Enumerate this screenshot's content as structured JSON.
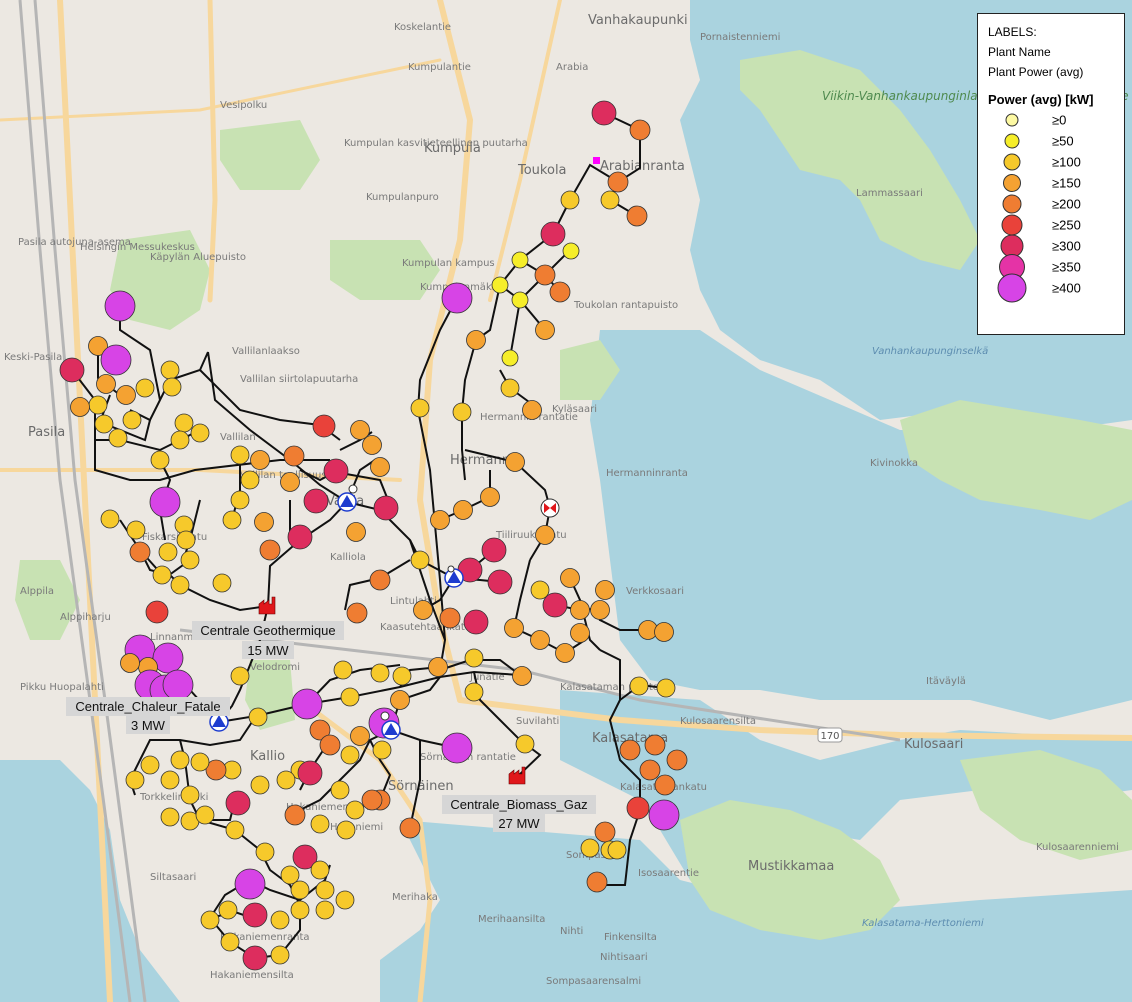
{
  "map": {
    "places": [
      {
        "name": "Vanhakaupunki",
        "cls": "place"
      },
      {
        "name": "Kumpula",
        "cls": "place"
      },
      {
        "name": "Toukola",
        "cls": "place"
      },
      {
        "name": "Arabianranta",
        "cls": "place"
      },
      {
        "name": "Pasila",
        "cls": "place"
      },
      {
        "name": "Keski-Pasila",
        "cls": "place-sm"
      },
      {
        "name": "Pasila autojuna-asema",
        "cls": "place-sm"
      },
      {
        "name": "Hermanni",
        "cls": "place"
      },
      {
        "name": "Kyläsaari",
        "cls": "place-sm"
      },
      {
        "name": "Hermanninranta",
        "cls": "place-sm"
      },
      {
        "name": "Verkkosaari",
        "cls": "place-sm"
      },
      {
        "name": "Vallila",
        "cls": "place"
      },
      {
        "name": "Kalasatama",
        "cls": "place"
      },
      {
        "name": "Sörnäinen",
        "cls": "place"
      },
      {
        "name": "Hakaniemi",
        "cls": "place-sm"
      },
      {
        "name": "Merihaka",
        "cls": "place-sm"
      },
      {
        "name": "Kulosaari",
        "cls": "place"
      },
      {
        "name": "Mustikkamaa",
        "cls": "place"
      },
      {
        "name": "Kivinokka",
        "cls": "place-sm"
      },
      {
        "name": "Lammassaari",
        "cls": "place-sm"
      },
      {
        "name": "Isosaarentie",
        "cls": "place-sm"
      },
      {
        "name": "Kulosaarenniemi",
        "cls": "place-sm"
      },
      {
        "name": "Pornaistenniemi",
        "cls": "place-sm"
      },
      {
        "name": "Helsingin Messukeskus",
        "cls": "place-sm"
      },
      {
        "name": "Toukolan rantapuisto",
        "cls": "place-sm"
      },
      {
        "name": "Kumpulan kampus",
        "cls": "place-sm"
      },
      {
        "name": "Vanhankaupunginselkä",
        "cls": "water-lbl"
      },
      {
        "name": "Viikin-Vanhankaupunginlahden luonnonsuojelualue",
        "cls": "park-lbl"
      },
      {
        "name": "Kalasatama-Herttoniemi",
        "cls": "water-lbl"
      },
      {
        "name": "Nihti",
        "cls": "place-sm"
      },
      {
        "name": "Kulosaarensilta",
        "cls": "place-sm"
      },
      {
        "name": "Itäväylä",
        "cls": "place-sm"
      },
      {
        "name": "Merihaansilta",
        "cls": "place-sm"
      },
      {
        "name": "Hakaniemensilta",
        "cls": "place-sm"
      },
      {
        "name": "Finkensilta",
        "cls": "place-sm"
      },
      {
        "name": "Vallilan teollisuusalue",
        "cls": "place-sm"
      },
      {
        "name": "Kumpulanpuro",
        "cls": "place-sm"
      },
      {
        "name": "Kumpulan kasvitieteellinen puutarha",
        "cls": "place-sm"
      },
      {
        "name": "Kumpulantie",
        "cls": "place-sm"
      },
      {
        "name": "Koskelantie",
        "cls": "place-sm"
      },
      {
        "name": "Vesipolku",
        "cls": "place-sm"
      },
      {
        "name": "Arabia",
        "cls": "place-sm"
      },
      {
        "name": "Käpylän Aluepuisto",
        "cls": "place-sm"
      },
      {
        "name": "Vallilanlaakso",
        "cls": "place-sm"
      },
      {
        "name": "Vallilan siirtolapuutarha",
        "cls": "place-sm"
      },
      {
        "name": "Suvilahti",
        "cls": "place-sm"
      },
      {
        "name": "Hakaniemen tori",
        "cls": "place-sm"
      },
      {
        "name": "Fiskarsinkatu",
        "cls": "place-sm"
      },
      {
        "name": "Tiiliruukinkatu",
        "cls": "place-sm"
      },
      {
        "name": "Junatie",
        "cls": "place-sm"
      },
      {
        "name": "Hermannin rantatie",
        "cls": "place-sm"
      },
      {
        "name": "Kaasutehtaankatu",
        "cls": "place-sm"
      },
      {
        "name": "Kalasatamankatu",
        "cls": "place-sm"
      },
      {
        "name": "Lintulahti",
        "cls": "place-sm"
      },
      {
        "name": "Pikku Huopalahti",
        "cls": "place-sm"
      },
      {
        "name": "Vallilan",
        "cls": "place-sm"
      },
      {
        "name": "Kumpulanmäki",
        "cls": "place-sm"
      },
      {
        "name": "Velodromi",
        "cls": "place-sm"
      },
      {
        "name": "Alppila",
        "cls": "place-sm"
      },
      {
        "name": "Alppiharju",
        "cls": "place-sm"
      },
      {
        "name": "Linnanmäki",
        "cls": "place-sm"
      },
      {
        "name": "Kalliola",
        "cls": "place-sm"
      },
      {
        "name": "Kallio",
        "cls": "place"
      },
      {
        "name": "Torkkelinmäki",
        "cls": "place-sm"
      },
      {
        "name": "Hakaniemenranta",
        "cls": "place-sm"
      },
      {
        "name": "Siltasaari",
        "cls": "place-sm"
      },
      {
        "name": "Sörnäisten rantatie",
        "cls": "place-sm"
      },
      {
        "name": "Kalasataman puisto",
        "cls": "place-sm"
      },
      {
        "name": "Sompasaari",
        "cls": "place-sm"
      },
      {
        "name": "Nihtisaari",
        "cls": "place-sm"
      },
      {
        "name": "Sompasaarensalmi",
        "cls": "place-sm"
      }
    ],
    "roads": {
      "shields": [
        "170"
      ]
    },
    "plants": [
      {
        "name": "Centrale Geothermique",
        "power": "15 MW"
      },
      {
        "name": "Centrale_Chaleur_Fatale",
        "power": "3 MW"
      },
      {
        "name": "Centrale_Biomass_Gaz",
        "power": "27 MW"
      }
    ],
    "colors": {
      "land": "#e9e6e1",
      "water": "#aad3df",
      "park": "#c8e2b3",
      "road": "#f7d79c",
      "network": "#111111",
      "plant": "#e0171b",
      "pump": "#1d3ccf"
    }
  },
  "legend": {
    "heading": "LABELS:",
    "label_1": "Plant Name",
    "label_2": "Plant Power (avg)",
    "title": "Power (avg) [kW]",
    "classes": [
      {
        "label": "≥0",
        "color": "#fdf9a3",
        "size": 13
      },
      {
        "label": "≥50",
        "color": "#f6ee2a",
        "size": 15
      },
      {
        "label": "≥100",
        "color": "#f6c92b",
        "size": 17
      },
      {
        "label": "≥150",
        "color": "#f4a232",
        "size": 18
      },
      {
        "label": "≥200",
        "color": "#ef7d32",
        "size": 19
      },
      {
        "label": "≥250",
        "color": "#e9423a",
        "size": 21
      },
      {
        "label": "≥300",
        "color": "#dd2d5e",
        "size": 23
      },
      {
        "label": "≥350",
        "color": "#e533a6",
        "size": 26
      },
      {
        "label": "≥400",
        "color": "#d744e6",
        "size": 29
      }
    ]
  }
}
